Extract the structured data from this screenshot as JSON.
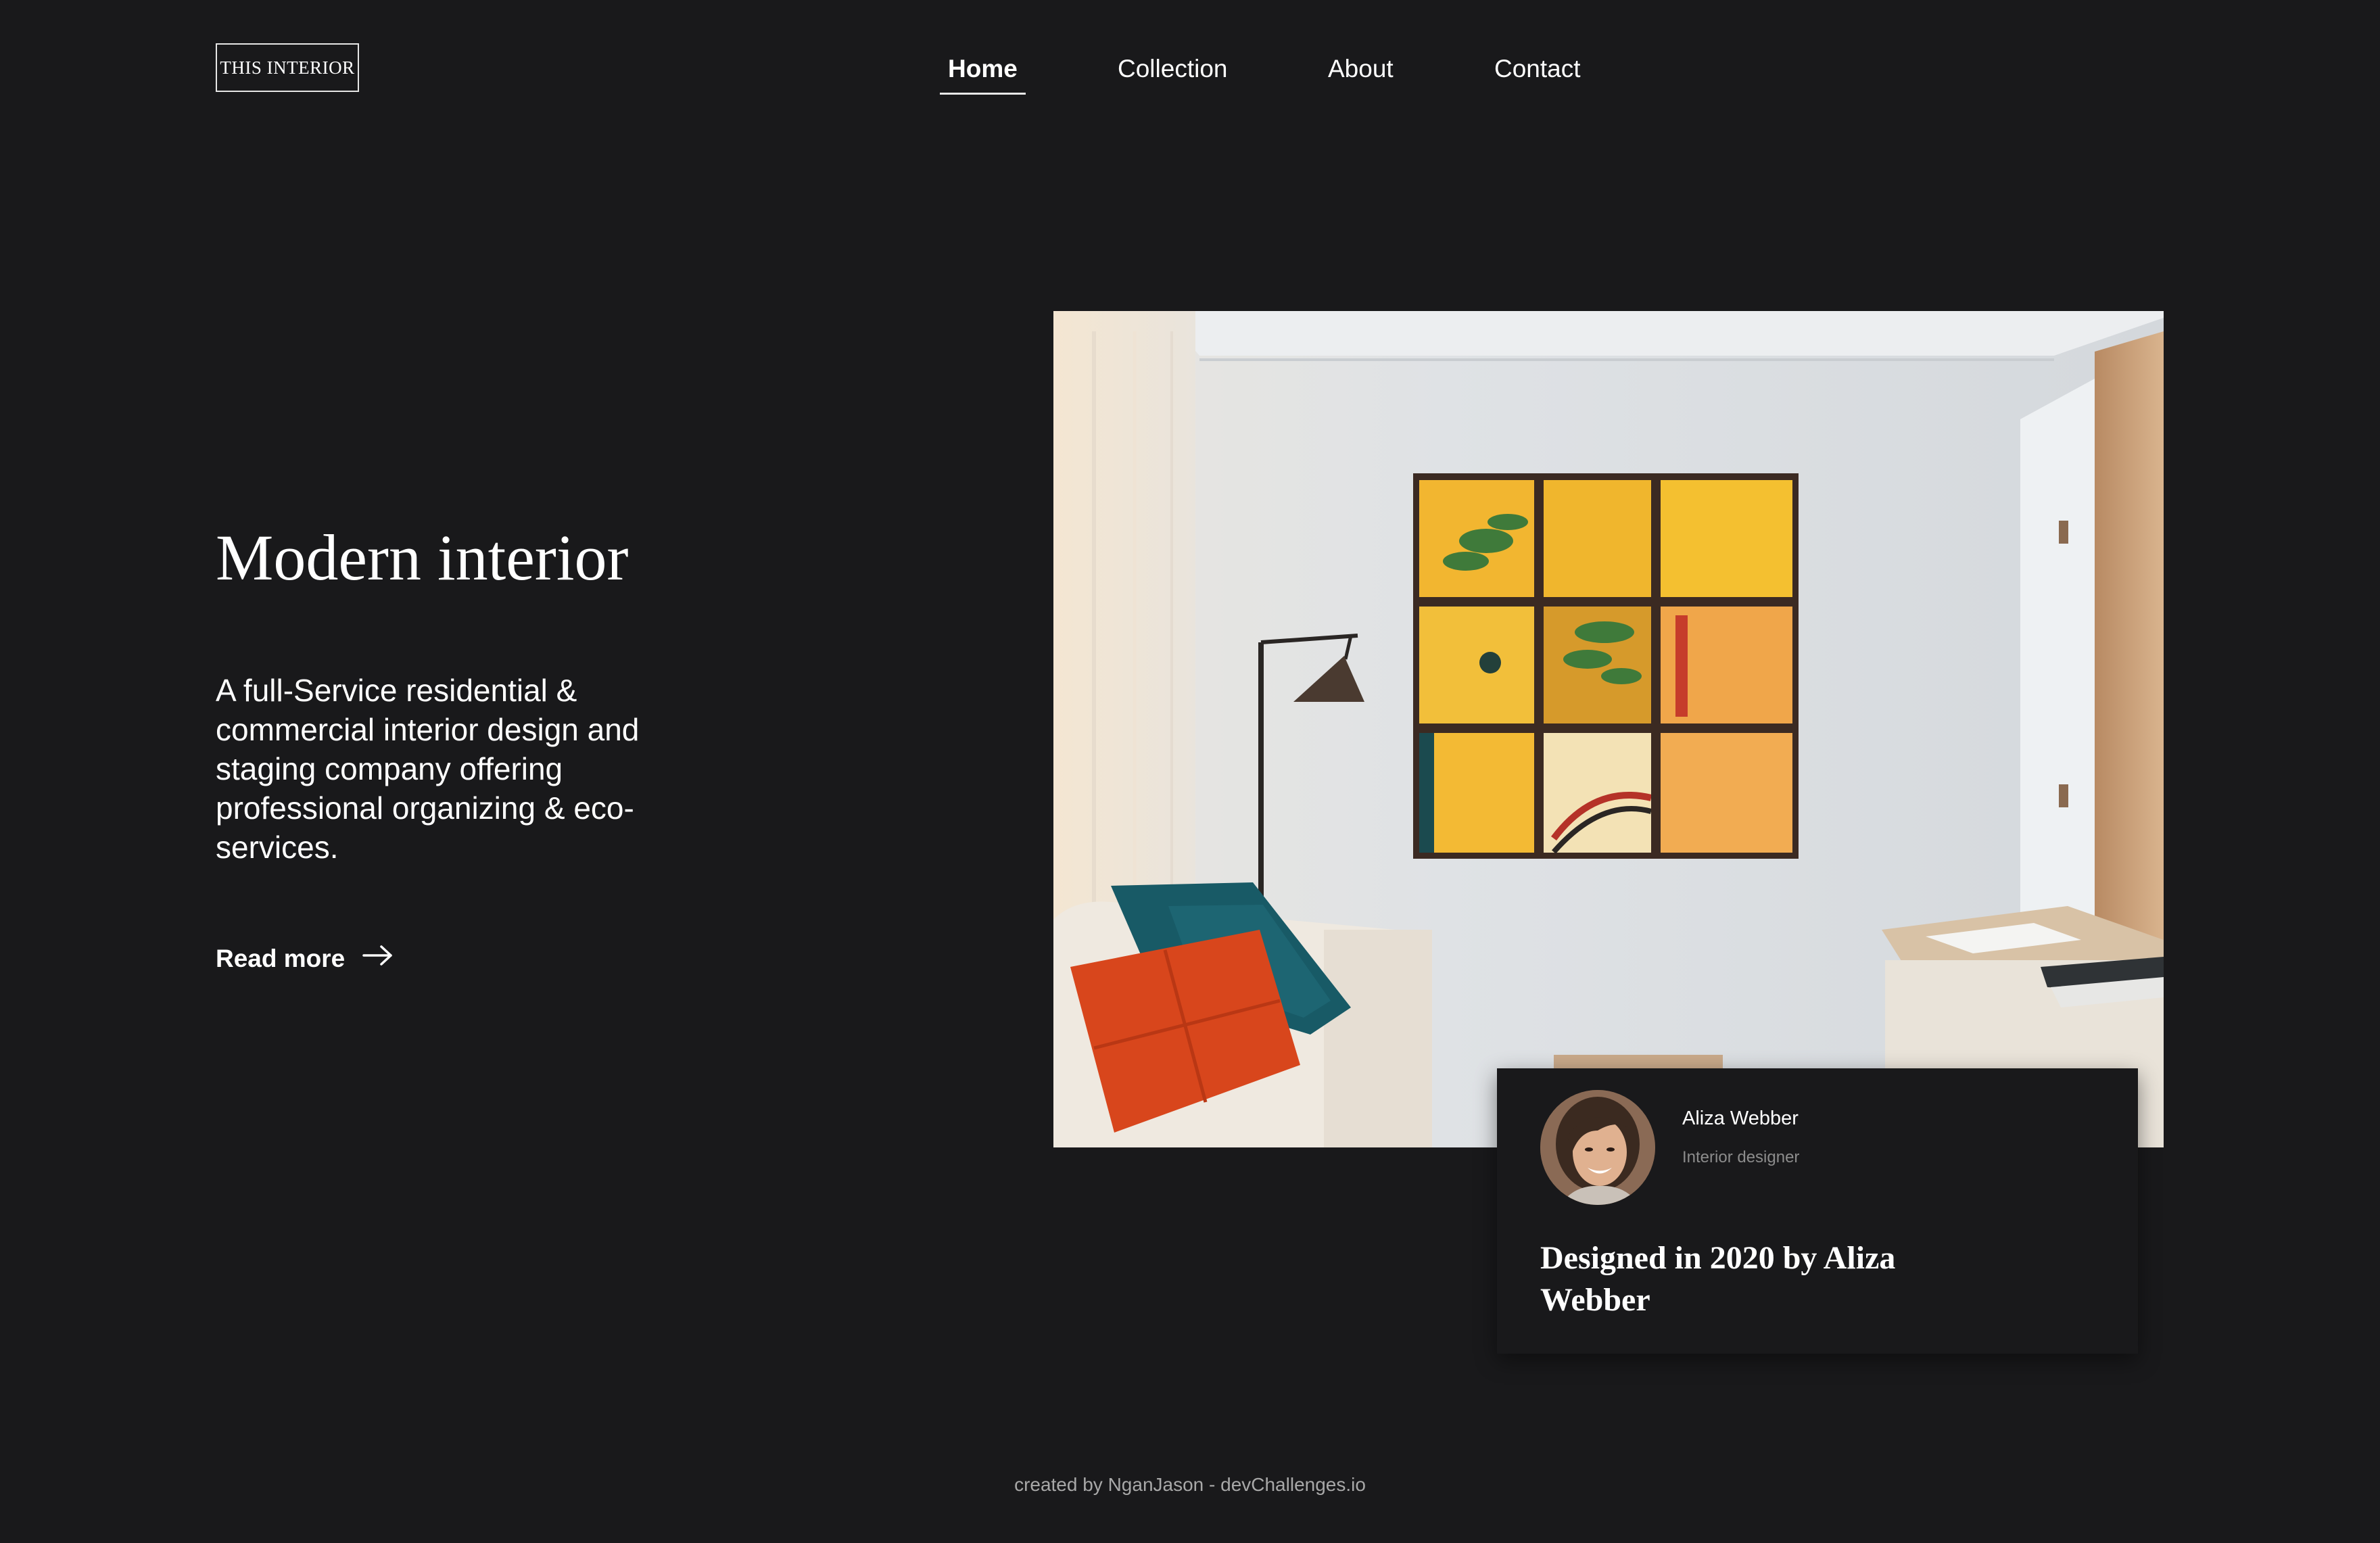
{
  "header": {
    "logo_text": "THIS INTERIOR",
    "nav": [
      {
        "label": "Home",
        "active": true
      },
      {
        "label": "Collection",
        "active": false
      },
      {
        "label": "About",
        "active": false
      },
      {
        "label": "Contact",
        "active": false
      }
    ]
  },
  "hero": {
    "title": "Modern interior",
    "description": "A full-Service residential & commercial interior design and staging company offering professional organizing & eco-services.",
    "read_more_label": "Read more",
    "read_more_icon": "arrow-right-icon"
  },
  "designer_card": {
    "name": "Aliza Webber",
    "role": "Interior designer",
    "caption": "Designed in 2020 by Aliza Webber"
  },
  "footer": {
    "credit": "created by NganJason - devChallenges.io"
  },
  "colors": {
    "background": "#19191b",
    "text": "#ffffff",
    "muted": "#8c8c8c",
    "pillow_orange": "#d8461c",
    "pillow_teal": "#185a66",
    "artwork_yellow": "#f2b630"
  }
}
